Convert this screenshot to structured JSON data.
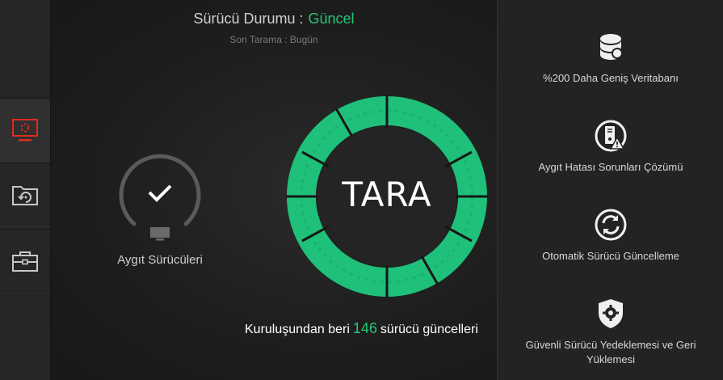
{
  "status": {
    "label": "Sürücü Durumu :",
    "value": "Güncel",
    "last_scan": "Son Tarama : Bugün"
  },
  "gauge": {
    "label": "Aygıt Sürücüleri"
  },
  "scan_button": {
    "label": "TARA"
  },
  "footer": {
    "prefix": "Kuruluşundan beri",
    "count": "146",
    "suffix": "sürücü güncelleri"
  },
  "features": [
    {
      "icon": "database-icon",
      "label": "%200 Daha Geniş Veritabanı"
    },
    {
      "icon": "device-warning-icon",
      "label": "Aygıt Hatası Sorunları Çözümü"
    },
    {
      "icon": "refresh-icon",
      "label": "Otomatik Sürücü Güncelleme"
    },
    {
      "icon": "shield-gear-icon",
      "label": "Güvenli Sürücü Yedeklemesi ve Geri Yüklemesi"
    }
  ],
  "colors": {
    "accent": "#22c776",
    "active_nav": "#e02b20"
  }
}
